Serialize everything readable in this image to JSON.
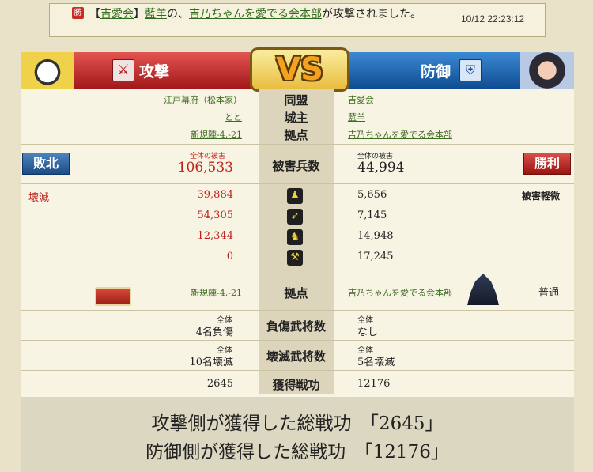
{
  "notification": {
    "badge": "勝",
    "bracket_open": "【",
    "alliance": "吉愛会",
    "bracket_close": "】",
    "lord": "藍羊",
    "particle": "の、",
    "target": "吉乃ちゃんを愛でる会本部",
    "suffix": "が攻撃されました。",
    "timestamp": "10/12 22:23:12"
  },
  "banner": {
    "attack_label": "攻撃",
    "vs": "VS",
    "defense_label": "防御"
  },
  "info": {
    "alliance_label": "同盟",
    "lord_label": "城主",
    "base_label": "拠点",
    "attacker_alliance": "江戸幕府（松本家）",
    "attacker_lord": "とと",
    "attacker_base": "新規陣-4,-21",
    "defender_alliance": "吉愛会",
    "defender_lord": "藍羊",
    "defender_base": "吉乃ちゃんを愛でる会本部"
  },
  "damage": {
    "label": "被害兵数",
    "caption": "全体の被害",
    "attacker_result": "敗北",
    "defender_result": "勝利",
    "attacker_total": "106,533",
    "defender_total": "44,994",
    "attacker_status": "壊滅",
    "defender_status": "被害軽微",
    "units": [
      {
        "icon": "spear-soldier-icon",
        "glyph": "♟",
        "attacker": "39,884",
        "defender": "5,656"
      },
      {
        "icon": "bow-icon",
        "glyph": "➶",
        "attacker": "54,305",
        "defender": "7,145"
      },
      {
        "icon": "horse-icon",
        "glyph": "♞",
        "attacker": "12,344",
        "defender": "14,948"
      },
      {
        "icon": "siege-weapon-icon",
        "glyph": "⚒",
        "attacker": "0",
        "defender": "17,245"
      }
    ]
  },
  "base_row": {
    "label": "拠点",
    "attacker_base": "新規陣-4,-21",
    "defender_base": "吉乃ちゃんを愛でる会本部",
    "defender_condition": "普通"
  },
  "generals": {
    "caption": "全体",
    "injured_label": "負傷武将数",
    "attacker_injured": "4名負傷",
    "defender_injured": "なし",
    "destroyed_label": "壊滅武将数",
    "attacker_destroyed": "10名壊滅",
    "defender_destroyed": "5名壊滅"
  },
  "merit": {
    "label": "獲得戦功",
    "attacker": "2645",
    "defender": "12176"
  },
  "footer": {
    "attacker_line": "攻撃側が獲得した総戦功　「2645」",
    "defender_line": "防御側が獲得した総戦功　「12176」"
  }
}
